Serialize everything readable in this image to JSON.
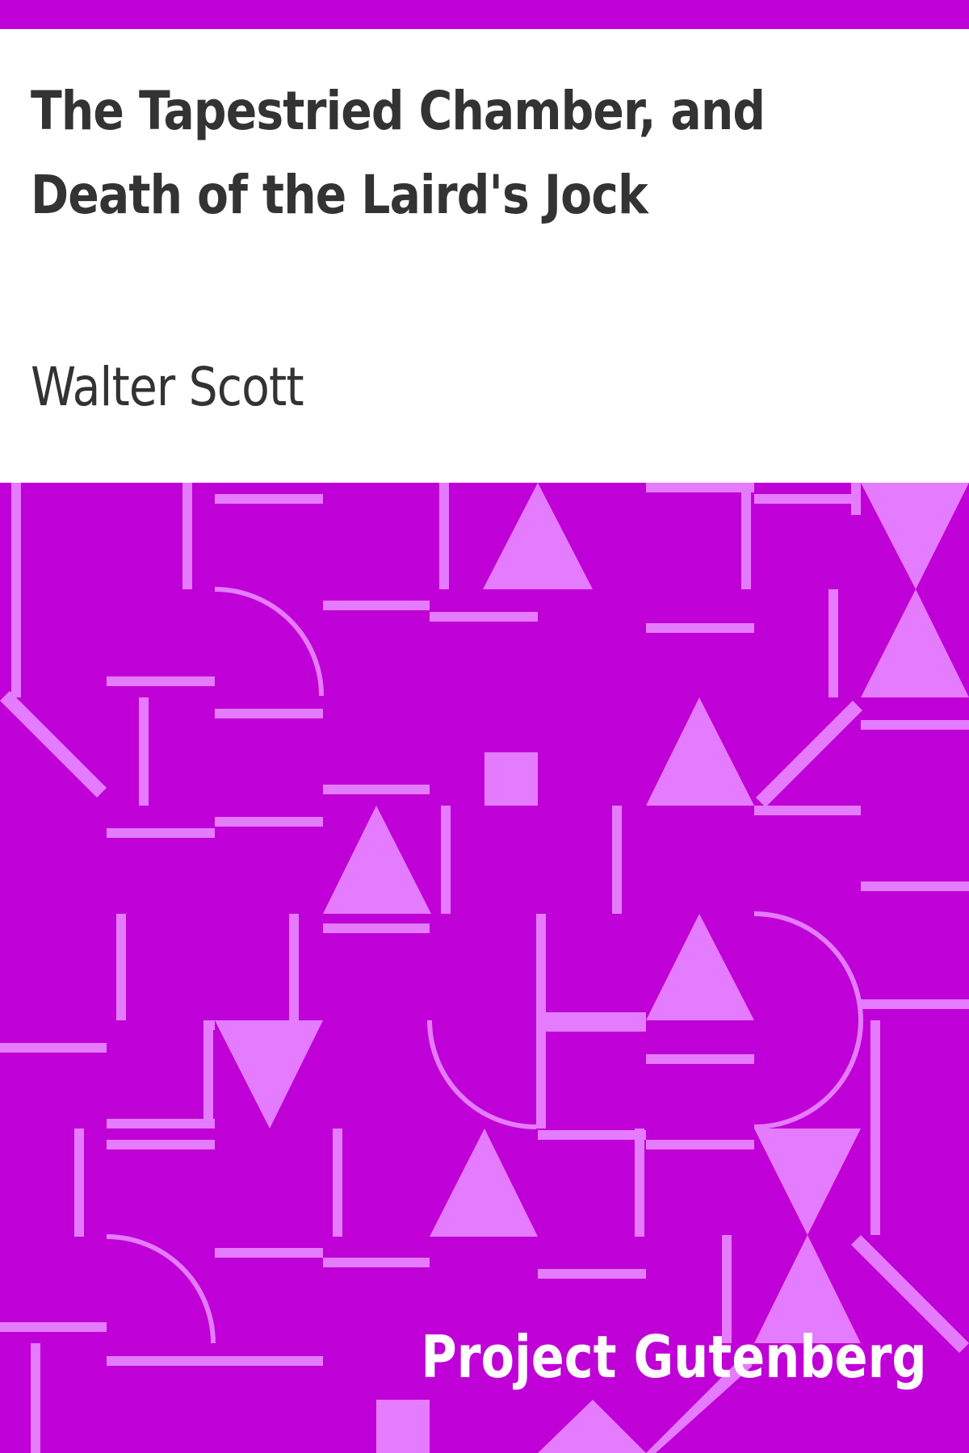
{
  "cover": {
    "title": "The Tapestried Chamber, and Death of the Laird's Jock",
    "author": "Walter Scott",
    "publisher": "Project Gutenberg"
  },
  "colors": {
    "background_band": "#bf00d6",
    "pattern_shape": "#e57bff",
    "title_text": "#333333",
    "brand_text": "#ffffff"
  }
}
